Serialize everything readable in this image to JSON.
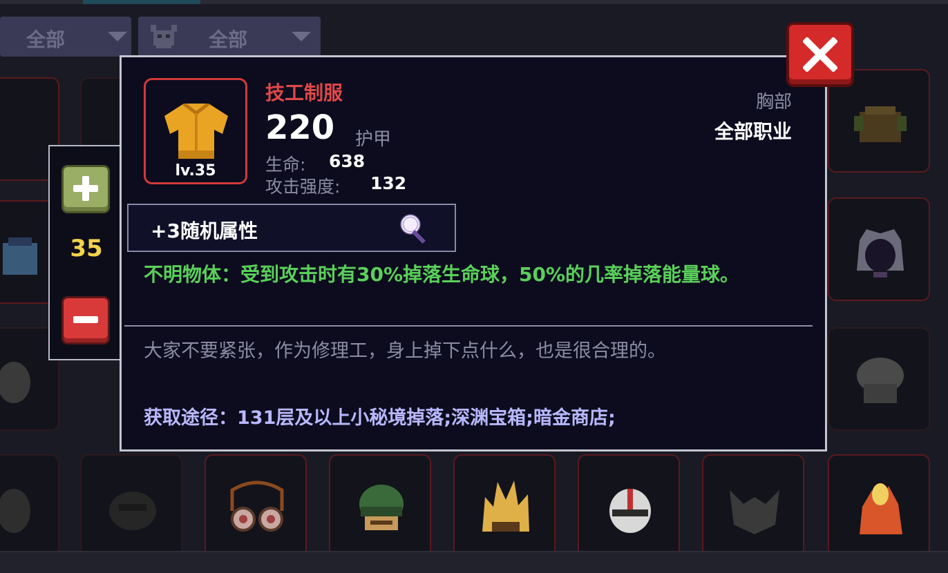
{
  "filters": [
    {
      "label": "全部"
    },
    {
      "label": "全部",
      "icon": "helmet-icon"
    }
  ],
  "quantity": {
    "value": "35"
  },
  "item": {
    "name": "技工制服",
    "level": "lv.35",
    "armor_value": "220",
    "armor_label": "护甲",
    "slot": "胸部",
    "class_requirement": "全部职业",
    "stats": [
      {
        "label": "生命:",
        "value": "638"
      },
      {
        "label": "攻击强度:",
        "value": "132"
      }
    ],
    "random_attributes": "+3随机属性",
    "effect": "不明物体：受到攻击时有30%掉落生命球，50%的几率掉落能量球。",
    "flavor": "大家不要紧张，作为修理工，身上掉下点什么，也是很合理的。",
    "source": "获取途径：131层及以上小秘境掉落;深渊宝箱;暗金商店;"
  },
  "colors": {
    "item_name": "#e04848",
    "effect_text": "#5ad05a",
    "source_text": "#b8b8ff",
    "quantity_text": "#f2d24a",
    "close_button": "#d42a2a"
  }
}
